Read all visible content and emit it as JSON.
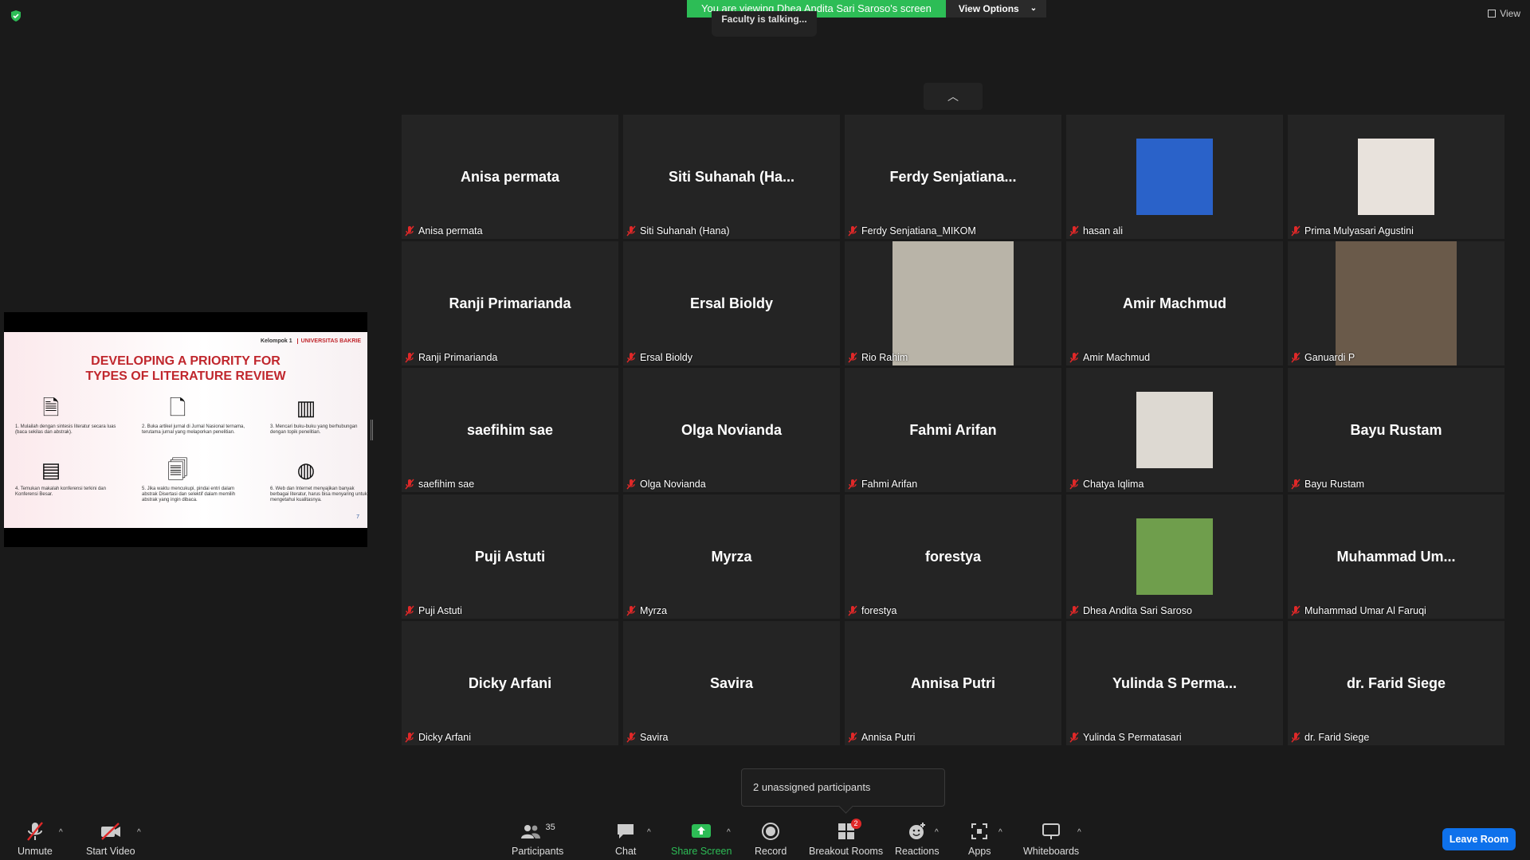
{
  "banner": {
    "text": "You are viewing Dhea Andita Sari Saroso's screen",
    "options_label": "View Options"
  },
  "talking": "Faculty is talking...",
  "view_label": "View",
  "slide": {
    "group": "Kelompok 1",
    "logo": "UNIVERSITAS BAKRIE",
    "title_line1": "DEVELOPING A PRIORITY FOR",
    "title_line2": "TYPES OF LITERATURE REVIEW",
    "items": [
      "1. Mulailah dengan sintesis literatur secara luas (baca sekilas dan abstrak).",
      "2. Buka artikel jurnal di Jurnal Nasional ternama, terutama jurnal yang melaporkan penelitian.",
      "3. Mencari buku-buku yang berhubungan dengan topik penelitian.",
      "4. Temukan makalah konferensi terkini dan Konferensi Besar.",
      "5. Jika waktu mencukupi, pindai entri dalam abstrak Disertasi dan selektif dalam memilih abstrak yang ingin dibaca.",
      "6. Web dan Internet menyajikan banyak berbagai literatur, harus bisa menyaring untuk mengetahui kualitasnya."
    ],
    "page": "7"
  },
  "participants": [
    {
      "tile": "Anisa permata",
      "label": "Anisa permata",
      "type": "name"
    },
    {
      "tile": "Siti Suhanah (Ha...",
      "label": "Siti Suhanah (Hana)",
      "type": "name"
    },
    {
      "tile": "Ferdy Senjatiana...",
      "label": "Ferdy Senjatiana_MIKOM",
      "type": "name"
    },
    {
      "tile": "",
      "label": "hasan ali",
      "type": "photo",
      "bg": "#2a62c9"
    },
    {
      "tile": "",
      "label": "Prima Mulyasari Agustini",
      "type": "photo",
      "bg": "#e8e2dc"
    },
    {
      "tile": "Ranji Primarianda",
      "label": "Ranji Primarianda",
      "type": "name"
    },
    {
      "tile": "Ersal Bioldy",
      "label": "Ersal Bioldy",
      "type": "name"
    },
    {
      "tile": "",
      "label": "Rio Rahim",
      "type": "video",
      "bg": "#b9b4a8"
    },
    {
      "tile": "Amir Machmud",
      "label": "Amir Machmud",
      "type": "name"
    },
    {
      "tile": "",
      "label": "Ganuardi P",
      "type": "video",
      "bg": "#6a5a4a"
    },
    {
      "tile": "saefihim sae",
      "label": "saefihim sae",
      "type": "name"
    },
    {
      "tile": "Olga Novianda",
      "label": "Olga Novianda",
      "type": "name"
    },
    {
      "tile": "Fahmi Arifan",
      "label": "Fahmi Arifan",
      "type": "name"
    },
    {
      "tile": "",
      "label": "Chatya Iqlima",
      "type": "photo",
      "bg": "#ddd9d2"
    },
    {
      "tile": "Bayu Rustam",
      "label": "Bayu Rustam",
      "type": "name"
    },
    {
      "tile": "Puji Astuti",
      "label": "Puji Astuti",
      "type": "name"
    },
    {
      "tile": "Myrza",
      "label": "Myrza",
      "type": "name"
    },
    {
      "tile": "forestya",
      "label": "forestya",
      "type": "name"
    },
    {
      "tile": "",
      "label": "Dhea Andita Sari Saroso",
      "type": "photo",
      "bg": "#6f9e4c"
    },
    {
      "tile": "Muhammad Um...",
      "label": "Muhammad Umar Al Faruqi",
      "type": "name"
    },
    {
      "tile": "Dicky Arfani",
      "label": "Dicky Arfani",
      "type": "name"
    },
    {
      "tile": "Savira",
      "label": "Savira",
      "type": "name"
    },
    {
      "tile": "Annisa Putri",
      "label": "Annisa Putri",
      "type": "name"
    },
    {
      "tile": "Yulinda S Perma...",
      "label": "Yulinda S Permatasari",
      "type": "name"
    },
    {
      "tile": "dr. Farid Siege",
      "label": "dr. Farid Siege",
      "type": "name"
    }
  ],
  "unassigned": "2 unassigned participants",
  "toolbar": {
    "unmute": "Unmute",
    "start_video": "Start Video",
    "participants": "Participants",
    "participants_count": "35",
    "chat": "Chat",
    "share_screen": "Share Screen",
    "record": "Record",
    "breakout_rooms": "Breakout Rooms",
    "breakout_badge": "2",
    "reactions": "Reactions",
    "apps": "Apps",
    "whiteboards": "Whiteboards",
    "leave": "Leave Room"
  },
  "colors": {
    "accent_green": "#2dbd56",
    "leave_blue": "#0e71eb",
    "mute_red": "#e02828"
  }
}
